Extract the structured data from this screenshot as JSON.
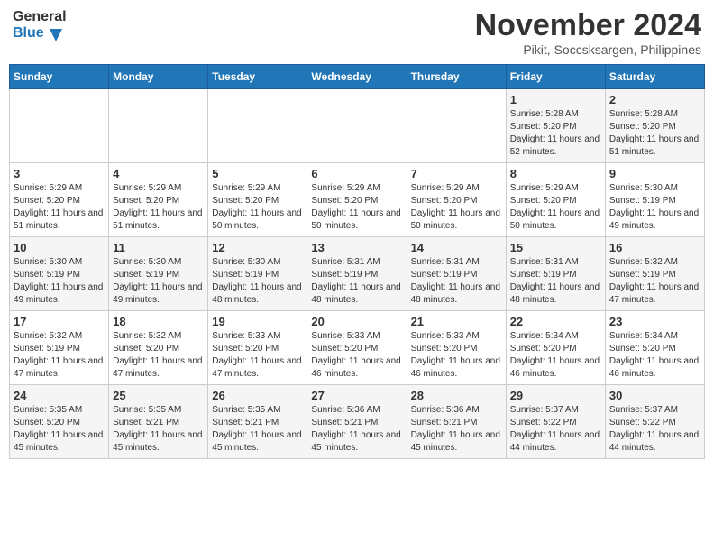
{
  "header": {
    "logo_line1": "General",
    "logo_line2": "Blue",
    "month_title": "November 2024",
    "location": "Pikit, Soccsksargen, Philippines"
  },
  "days_of_week": [
    "Sunday",
    "Monday",
    "Tuesday",
    "Wednesday",
    "Thursday",
    "Friday",
    "Saturday"
  ],
  "weeks": [
    [
      {
        "num": "",
        "info": ""
      },
      {
        "num": "",
        "info": ""
      },
      {
        "num": "",
        "info": ""
      },
      {
        "num": "",
        "info": ""
      },
      {
        "num": "",
        "info": ""
      },
      {
        "num": "1",
        "info": "Sunrise: 5:28 AM\nSunset: 5:20 PM\nDaylight: 11 hours and 52 minutes."
      },
      {
        "num": "2",
        "info": "Sunrise: 5:28 AM\nSunset: 5:20 PM\nDaylight: 11 hours and 51 minutes."
      }
    ],
    [
      {
        "num": "3",
        "info": "Sunrise: 5:29 AM\nSunset: 5:20 PM\nDaylight: 11 hours and 51 minutes."
      },
      {
        "num": "4",
        "info": "Sunrise: 5:29 AM\nSunset: 5:20 PM\nDaylight: 11 hours and 51 minutes."
      },
      {
        "num": "5",
        "info": "Sunrise: 5:29 AM\nSunset: 5:20 PM\nDaylight: 11 hours and 50 minutes."
      },
      {
        "num": "6",
        "info": "Sunrise: 5:29 AM\nSunset: 5:20 PM\nDaylight: 11 hours and 50 minutes."
      },
      {
        "num": "7",
        "info": "Sunrise: 5:29 AM\nSunset: 5:20 PM\nDaylight: 11 hours and 50 minutes."
      },
      {
        "num": "8",
        "info": "Sunrise: 5:29 AM\nSunset: 5:20 PM\nDaylight: 11 hours and 50 minutes."
      },
      {
        "num": "9",
        "info": "Sunrise: 5:30 AM\nSunset: 5:19 PM\nDaylight: 11 hours and 49 minutes."
      }
    ],
    [
      {
        "num": "10",
        "info": "Sunrise: 5:30 AM\nSunset: 5:19 PM\nDaylight: 11 hours and 49 minutes."
      },
      {
        "num": "11",
        "info": "Sunrise: 5:30 AM\nSunset: 5:19 PM\nDaylight: 11 hours and 49 minutes."
      },
      {
        "num": "12",
        "info": "Sunrise: 5:30 AM\nSunset: 5:19 PM\nDaylight: 11 hours and 48 minutes."
      },
      {
        "num": "13",
        "info": "Sunrise: 5:31 AM\nSunset: 5:19 PM\nDaylight: 11 hours and 48 minutes."
      },
      {
        "num": "14",
        "info": "Sunrise: 5:31 AM\nSunset: 5:19 PM\nDaylight: 11 hours and 48 minutes."
      },
      {
        "num": "15",
        "info": "Sunrise: 5:31 AM\nSunset: 5:19 PM\nDaylight: 11 hours and 48 minutes."
      },
      {
        "num": "16",
        "info": "Sunrise: 5:32 AM\nSunset: 5:19 PM\nDaylight: 11 hours and 47 minutes."
      }
    ],
    [
      {
        "num": "17",
        "info": "Sunrise: 5:32 AM\nSunset: 5:19 PM\nDaylight: 11 hours and 47 minutes."
      },
      {
        "num": "18",
        "info": "Sunrise: 5:32 AM\nSunset: 5:20 PM\nDaylight: 11 hours and 47 minutes."
      },
      {
        "num": "19",
        "info": "Sunrise: 5:33 AM\nSunset: 5:20 PM\nDaylight: 11 hours and 47 minutes."
      },
      {
        "num": "20",
        "info": "Sunrise: 5:33 AM\nSunset: 5:20 PM\nDaylight: 11 hours and 46 minutes."
      },
      {
        "num": "21",
        "info": "Sunrise: 5:33 AM\nSunset: 5:20 PM\nDaylight: 11 hours and 46 minutes."
      },
      {
        "num": "22",
        "info": "Sunrise: 5:34 AM\nSunset: 5:20 PM\nDaylight: 11 hours and 46 minutes."
      },
      {
        "num": "23",
        "info": "Sunrise: 5:34 AM\nSunset: 5:20 PM\nDaylight: 11 hours and 46 minutes."
      }
    ],
    [
      {
        "num": "24",
        "info": "Sunrise: 5:35 AM\nSunset: 5:20 PM\nDaylight: 11 hours and 45 minutes."
      },
      {
        "num": "25",
        "info": "Sunrise: 5:35 AM\nSunset: 5:21 PM\nDaylight: 11 hours and 45 minutes."
      },
      {
        "num": "26",
        "info": "Sunrise: 5:35 AM\nSunset: 5:21 PM\nDaylight: 11 hours and 45 minutes."
      },
      {
        "num": "27",
        "info": "Sunrise: 5:36 AM\nSunset: 5:21 PM\nDaylight: 11 hours and 45 minutes."
      },
      {
        "num": "28",
        "info": "Sunrise: 5:36 AM\nSunset: 5:21 PM\nDaylight: 11 hours and 45 minutes."
      },
      {
        "num": "29",
        "info": "Sunrise: 5:37 AM\nSunset: 5:22 PM\nDaylight: 11 hours and 44 minutes."
      },
      {
        "num": "30",
        "info": "Sunrise: 5:37 AM\nSunset: 5:22 PM\nDaylight: 11 hours and 44 minutes."
      }
    ]
  ]
}
